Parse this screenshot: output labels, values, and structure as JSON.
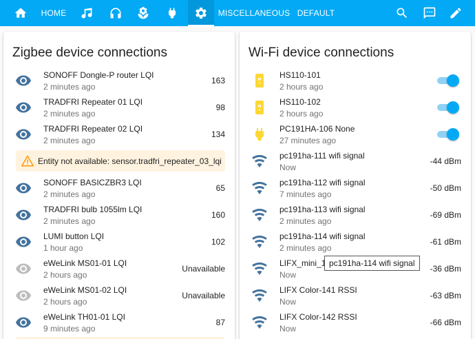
{
  "colors": {
    "primary": "#03a9f4",
    "eye_active": "#44739e",
    "eye_unavailable": "#bdbdbd",
    "warning": "#ff9800",
    "warning_bg": "#fff3e0",
    "plug_yellow": "#fdd835"
  },
  "topbar": {
    "home_label": "HOME",
    "misc_label": "MISCELLANEOUS",
    "default_label": "DEFAULT",
    "icons": [
      "home-icon",
      "music-icon",
      "headphones-icon",
      "flower-icon",
      "power-plug-icon",
      "gear-icon",
      "search-icon",
      "chat-icon",
      "pencil-icon"
    ]
  },
  "zigbee": {
    "title": "Zigbee device connections",
    "rows": [
      {
        "name": "SONOFF Dongle-P router LQI",
        "time": "2 minutes ago",
        "value": "163",
        "icon": "eye-icon",
        "available": true
      },
      {
        "name": "TRADFRI Repeater 01 LQI",
        "time": "2 minutes ago",
        "value": "98",
        "icon": "eye-icon",
        "available": true
      },
      {
        "name": "TRADFRI Repeater 02 LQI",
        "time": "2 minutes ago",
        "value": "134",
        "icon": "eye-icon",
        "available": true
      },
      {
        "name": "SONOFF BASICZBR3 LQI",
        "time": "2 minutes ago",
        "value": "65",
        "icon": "eye-icon",
        "available": true
      },
      {
        "name": "TRADFRI bulb 1055lm LQI",
        "time": "2 minutes ago",
        "value": "160",
        "icon": "eye-icon",
        "available": true
      },
      {
        "name": "LUMI button LQI",
        "time": "1 hour ago",
        "value": "102",
        "icon": "eye-icon",
        "available": true
      },
      {
        "name": "eWeLink MS01-01 LQI",
        "time": "2 hours ago",
        "value": "Unavailable",
        "icon": "eye-icon",
        "available": false
      },
      {
        "name": "eWeLink MS01-02 LQI",
        "time": "2 hours ago",
        "value": "Unavailable",
        "icon": "eye-icon",
        "available": false
      },
      {
        "name": "eWeLink TH01-01 LQI",
        "time": "9 minutes ago",
        "value": "87",
        "icon": "eye-icon",
        "available": true
      }
    ],
    "warning_text": "Entity not available: sensor.tradfri_repeater_03_lqi"
  },
  "wifi": {
    "title": "Wi-Fi device connections",
    "switch_rows": [
      {
        "name": "HS110-101",
        "time": "2 hours ago",
        "icon": "smart-plug-icon",
        "on": true
      },
      {
        "name": "HS110-102",
        "time": "2 hours ago",
        "icon": "smart-plug-icon",
        "on": true
      },
      {
        "name": "PC191HA-106 None",
        "time": "27 minutes ago",
        "icon": "power-plug-icon",
        "on": true
      }
    ],
    "signal_rows": [
      {
        "name": "pc191ha-111 wifi signal",
        "time": "Now",
        "value": "-44 dBm",
        "icon": "wifi-icon"
      },
      {
        "name": "pc191ha-112 wifi signal",
        "time": "7 minutes ago",
        "value": "-50 dBm",
        "icon": "wifi-icon"
      },
      {
        "name": "pc191ha-113 wifi signal",
        "time": "2 minutes ago",
        "value": "-69 dBm",
        "icon": "wifi-icon"
      },
      {
        "name": "pc191ha-114 wifi signal",
        "time": "2 minutes ago",
        "value": "-61 dBm",
        "icon": "wifi-icon"
      },
      {
        "name": "LIFX_mini_14",
        "time": "Now",
        "value": "-36 dBm",
        "icon": "wifi-icon"
      },
      {
        "name": "LIFX Color-141 RSSI",
        "time": "Now",
        "value": "-63 dBm",
        "icon": "wifi-icon"
      },
      {
        "name": "LIFX Color-142 RSSI",
        "time": "Now",
        "value": "-66 dBm",
        "icon": "wifi-icon"
      }
    ],
    "tooltip": "pc191ha-114 wifi signal"
  }
}
